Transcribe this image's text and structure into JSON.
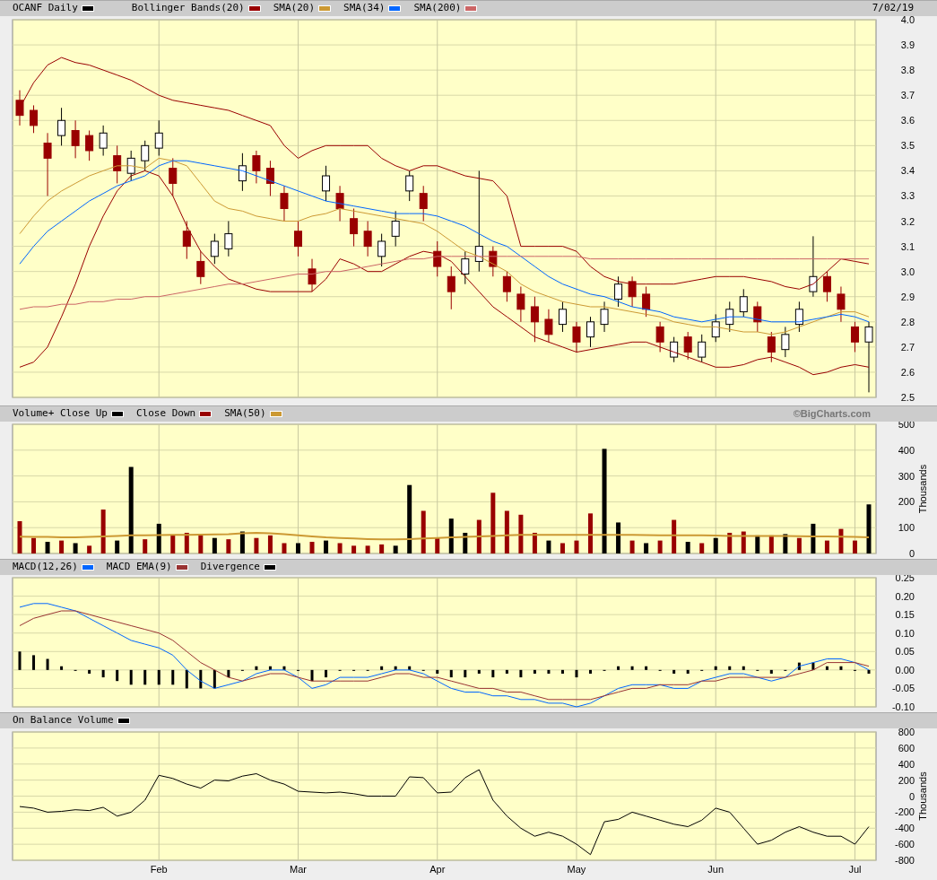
{
  "panels": [
    {
      "date": "7/02/19",
      "chart_data": {
        "type": "line",
        "grid": true,
        "ylim": [
          2.5,
          4.0
        ],
        "yticks": [
          {
            "value": 2.5,
            "label": "2.5"
          },
          {
            "value": 2.6,
            "label": "2.6"
          },
          {
            "value": 2.7,
            "label": "2.7"
          },
          {
            "value": 2.8,
            "label": "2.8"
          },
          {
            "value": 2.9,
            "label": "2.9"
          },
          {
            "value": 3.0,
            "label": "3.0"
          },
          {
            "value": 3.1,
            "label": "3.1"
          },
          {
            "value": 3.2,
            "label": "3.2"
          },
          {
            "value": 3.3,
            "label": "3.3"
          },
          {
            "value": 3.4,
            "label": "3.4"
          },
          {
            "value": 3.5,
            "label": "3.5"
          },
          {
            "value": 3.6,
            "label": "3.6"
          },
          {
            "value": 3.7,
            "label": "3.7"
          },
          {
            "value": 3.8,
            "label": "3.8"
          },
          {
            "value": 3.9,
            "label": "3.9"
          },
          {
            "value": 4.0,
            "label": "4.0"
          }
        ],
        "series": [
          {
            "name": "OCANF Daily",
            "type": "candlestick",
            "ohlc": [
              [
                3.68,
                3.72,
                3.58,
                3.62
              ],
              [
                3.64,
                3.66,
                3.55,
                3.58
              ],
              [
                3.51,
                3.55,
                3.3,
                3.45
              ],
              [
                3.54,
                3.65,
                3.5,
                3.6
              ],
              [
                3.56,
                3.6,
                3.45,
                3.5
              ],
              [
                3.54,
                3.56,
                3.44,
                3.48
              ],
              [
                3.49,
                3.58,
                3.46,
                3.55
              ],
              [
                3.46,
                3.5,
                3.35,
                3.4
              ],
              [
                3.39,
                3.48,
                3.36,
                3.45
              ],
              [
                3.44,
                3.52,
                3.4,
                3.5
              ],
              [
                3.49,
                3.6,
                3.46,
                3.55
              ],
              [
                3.41,
                3.45,
                3.3,
                3.35
              ],
              [
                3.16,
                3.2,
                3.05,
                3.1
              ],
              [
                3.04,
                3.08,
                2.95,
                2.98
              ],
              [
                3.06,
                3.15,
                3.03,
                3.12
              ],
              [
                3.09,
                3.2,
                3.06,
                3.15
              ],
              [
                3.36,
                3.47,
                3.32,
                3.42
              ],
              [
                3.46,
                3.48,
                3.35,
                3.4
              ],
              [
                3.41,
                3.44,
                3.3,
                3.35
              ],
              [
                3.31,
                3.34,
                3.2,
                3.25
              ],
              [
                3.16,
                3.2,
                3.06,
                3.1
              ],
              [
                3.01,
                3.05,
                2.92,
                2.95
              ],
              [
                3.32,
                3.42,
                3.28,
                3.38
              ],
              [
                3.31,
                3.34,
                3.2,
                3.25
              ],
              [
                3.21,
                3.25,
                3.1,
                3.15
              ],
              [
                3.16,
                3.2,
                3.06,
                3.1
              ],
              [
                3.06,
                3.15,
                3.02,
                3.12
              ],
              [
                3.14,
                3.24,
                3.1,
                3.2
              ],
              [
                3.32,
                3.4,
                3.28,
                3.38
              ],
              [
                3.31,
                3.34,
                3.2,
                3.25
              ],
              [
                3.08,
                3.12,
                2.98,
                3.02
              ],
              [
                2.98,
                3.02,
                2.85,
                2.92
              ],
              [
                2.99,
                3.08,
                2.95,
                3.05
              ],
              [
                3.04,
                3.4,
                3.0,
                3.1
              ],
              [
                3.08,
                3.1,
                2.98,
                3.02
              ],
              [
                2.98,
                3.0,
                2.88,
                2.92
              ],
              [
                2.91,
                2.94,
                2.8,
                2.85
              ],
              [
                2.86,
                2.9,
                2.72,
                2.8
              ],
              [
                2.81,
                2.85,
                2.72,
                2.75
              ],
              [
                2.79,
                2.88,
                2.76,
                2.85
              ],
              [
                2.78,
                2.8,
                2.68,
                2.72
              ],
              [
                2.74,
                2.82,
                2.7,
                2.8
              ],
              [
                2.79,
                2.88,
                2.76,
                2.85
              ],
              [
                2.89,
                2.98,
                2.86,
                2.95
              ],
              [
                2.96,
                2.98,
                2.86,
                2.9
              ],
              [
                2.91,
                2.94,
                2.82,
                2.85
              ],
              [
                2.78,
                2.8,
                2.68,
                2.72
              ],
              [
                2.66,
                2.74,
                2.64,
                2.72
              ],
              [
                2.74,
                2.76,
                2.65,
                2.68
              ],
              [
                2.66,
                2.75,
                2.64,
                2.72
              ],
              [
                2.74,
                2.83,
                2.72,
                2.8
              ],
              [
                2.79,
                2.88,
                2.76,
                2.85
              ],
              [
                2.84,
                2.93,
                2.82,
                2.9
              ],
              [
                2.86,
                2.88,
                2.76,
                2.8
              ],
              [
                2.74,
                2.76,
                2.64,
                2.68
              ],
              [
                2.69,
                2.78,
                2.66,
                2.75
              ],
              [
                2.79,
                2.88,
                2.76,
                2.85
              ],
              [
                2.92,
                3.14,
                2.9,
                2.98
              ],
              [
                2.98,
                3.0,
                2.88,
                2.92
              ],
              [
                2.91,
                2.94,
                2.8,
                2.85
              ],
              [
                2.78,
                2.8,
                2.68,
                2.72
              ],
              [
                2.72,
                2.8,
                2.52,
                2.78
              ]
            ]
          },
          {
            "name": "Bollinger Bands(20)",
            "type": "line",
            "color": "#990000",
            "values": [
              3.65,
              3.75,
              3.82,
              3.85,
              3.83,
              3.82,
              3.8,
              3.78,
              3.76,
              3.73,
              3.7,
              3.68,
              3.67,
              3.66,
              3.65,
              3.64,
              3.62,
              3.6,
              3.58,
              3.5,
              3.45,
              3.48,
              3.5,
              3.5,
              3.5,
              3.5,
              3.45,
              3.42,
              3.4,
              3.42,
              3.42,
              3.4,
              3.38,
              3.37,
              3.36,
              3.3,
              3.1,
              3.1,
              3.1,
              3.1,
              3.08,
              3.02,
              2.98,
              2.96,
              2.95,
              2.95,
              2.95,
              2.95,
              2.96,
              2.97,
              2.98,
              2.98,
              2.98,
              2.97,
              2.96,
              2.94,
              2.93,
              2.95,
              3.0,
              3.05,
              3.04,
              3.03
            ]
          },
          {
            "type": "line",
            "color": "#990000",
            "values": [
              2.62,
              2.64,
              2.7,
              2.82,
              2.95,
              3.1,
              3.22,
              3.32,
              3.38,
              3.4,
              3.38,
              3.3,
              3.18,
              3.08,
              3.02,
              2.97,
              2.95,
              2.93,
              2.92,
              2.92,
              2.92,
              2.92,
              2.97,
              3.05,
              3.03,
              3.0,
              3.0,
              3.03,
              3.06,
              3.08,
              3.07,
              3.04,
              2.98,
              2.92,
              2.86,
              2.82,
              2.78,
              2.74,
              2.72,
              2.7,
              2.68,
              2.69,
              2.7,
              2.71,
              2.72,
              2.72,
              2.7,
              2.68,
              2.66,
              2.64,
              2.62,
              2.62,
              2.63,
              2.65,
              2.66,
              2.64,
              2.62,
              2.59,
              2.6,
              2.62,
              2.63,
              2.62
            ]
          },
          {
            "name": "SMA(20)",
            "type": "line",
            "color": "#cc9933",
            "values": [
              3.15,
              3.22,
              3.28,
              3.32,
              3.35,
              3.38,
              3.4,
              3.42,
              3.42,
              3.41,
              3.45,
              3.44,
              3.42,
              3.35,
              3.28,
              3.25,
              3.24,
              3.22,
              3.21,
              3.2,
              3.2,
              3.22,
              3.23,
              3.25,
              3.24,
              3.23,
              3.22,
              3.21,
              3.2,
              3.19,
              3.16,
              3.12,
              3.08,
              3.06,
              3.03,
              3.0,
              2.95,
              2.92,
              2.9,
              2.88,
              2.87,
              2.86,
              2.86,
              2.85,
              2.84,
              2.83,
              2.82,
              2.8,
              2.79,
              2.78,
              2.78,
              2.77,
              2.76,
              2.76,
              2.75,
              2.76,
              2.78,
              2.8,
              2.82,
              2.84,
              2.84,
              2.82
            ]
          },
          {
            "name": "SMA(34)",
            "type": "line",
            "color": "#0066ff",
            "values": [
              3.03,
              3.1,
              3.16,
              3.2,
              3.24,
              3.28,
              3.31,
              3.34,
              3.36,
              3.38,
              3.42,
              3.44,
              3.44,
              3.43,
              3.42,
              3.41,
              3.4,
              3.38,
              3.36,
              3.34,
              3.32,
              3.3,
              3.28,
              3.27,
              3.26,
              3.25,
              3.24,
              3.23,
              3.23,
              3.23,
              3.22,
              3.2,
              3.18,
              3.15,
              3.12,
              3.1,
              3.06,
              3.02,
              2.98,
              2.95,
              2.93,
              2.91,
              2.9,
              2.88,
              2.86,
              2.85,
              2.84,
              2.82,
              2.81,
              2.8,
              2.81,
              2.82,
              2.82,
              2.81,
              2.8,
              2.8,
              2.8,
              2.81,
              2.82,
              2.83,
              2.82,
              2.8
            ]
          },
          {
            "name": "SMA(200)",
            "type": "line",
            "color": "#cc6666",
            "values": [
              2.85,
              2.86,
              2.86,
              2.87,
              2.87,
              2.88,
              2.88,
              2.89,
              2.89,
              2.9,
              2.9,
              2.91,
              2.92,
              2.93,
              2.94,
              2.95,
              2.95,
              2.96,
              2.97,
              2.98,
              2.99,
              2.99,
              3.0,
              3.0,
              3.01,
              3.02,
              3.03,
              3.04,
              3.05,
              3.05,
              3.06,
              3.06,
              3.06,
              3.06,
              3.06,
              3.06,
              3.06,
              3.06,
              3.06,
              3.06,
              3.06,
              3.05,
              3.05,
              3.05,
              3.05,
              3.05,
              3.05,
              3.05,
              3.05,
              3.05,
              3.05,
              3.05,
              3.05,
              3.05,
              3.05,
              3.05,
              3.05,
              3.05,
              3.05,
              3.05,
              3.05,
              3.05
            ]
          }
        ]
      }
    },
    {
      "credit": "©BigCharts.com",
      "chart_data": {
        "type": "bar",
        "grid": true,
        "ylabel": "Thousands",
        "ylim": [
          0,
          500
        ],
        "yticks": [
          0,
          100,
          200,
          300,
          400,
          500
        ],
        "series": [
          {
            "name": "Volume+ Close Up",
            "type": "bar",
            "color": "#000000",
            "values": [
              null,
              null,
              45,
              null,
              40,
              null,
              null,
              50,
              335,
              null,
              115,
              null,
              null,
              null,
              60,
              null,
              85,
              null,
              null,
              null,
              40,
              null,
              50,
              null,
              null,
              null,
              null,
              30,
              265,
              null,
              null,
              135,
              80,
              null,
              null,
              null,
              null,
              null,
              50,
              null,
              null,
              null,
              405,
              120,
              null,
              40,
              null,
              null,
              45,
              null,
              60,
              null,
              null,
              70,
              null,
              75,
              null,
              115,
              null,
              null,
              null,
              190
            ]
          },
          {
            "name": "Close Down",
            "type": "bar",
            "color": "#990000",
            "values": [
              125,
              60,
              null,
              50,
              null,
              30,
              170,
              null,
              null,
              55,
              null,
              70,
              80,
              75,
              null,
              55,
              null,
              60,
              70,
              40,
              null,
              45,
              null,
              40,
              30,
              30,
              35,
              null,
              null,
              165,
              60,
              null,
              null,
              130,
              235,
              165,
              150,
              80,
              null,
              40,
              50,
              155,
              null,
              null,
              50,
              null,
              50,
              130,
              null,
              40,
              null,
              80,
              85,
              null,
              70,
              null,
              60,
              null,
              50,
              95,
              50,
              null
            ]
          },
          {
            "name": "SMA(50)",
            "type": "line",
            "color": "#cc9933",
            "values": [
              65,
              64,
              64,
              63,
              63,
              64,
              66,
              68,
              70,
              70,
              71,
              72,
              72,
              73,
              74,
              75,
              78,
              80,
              78,
              75,
              70,
              66,
              62,
              60,
              58,
              56,
              55,
              55,
              56,
              58,
              60,
              62,
              64,
              66,
              68,
              70,
              72,
              72,
              72,
              72,
              72,
              72,
              72,
              72,
              72,
              71,
              70,
              70,
              70,
              70,
              69,
              68,
              68,
              68,
              68,
              68,
              67,
              66,
              66,
              65,
              64,
              63
            ]
          }
        ]
      }
    },
    {
      "chart_data": {
        "type": "line",
        "grid": true,
        "ylim": [
          -0.1,
          0.25
        ],
        "yticks": [
          {
            "value": -0.1,
            "label": "-0.10"
          },
          {
            "value": -0.05,
            "label": "-0.05"
          },
          {
            "value": 0,
            "label": "0.00"
          },
          {
            "value": 0.05,
            "label": "0.05"
          },
          {
            "value": 0.1,
            "label": "0.10"
          },
          {
            "value": 0.15,
            "label": "0.15"
          },
          {
            "value": 0.2,
            "label": "0.20"
          },
          {
            "value": 0.25,
            "label": "0.25"
          }
        ],
        "series": [
          {
            "name": "MACD(12,26)",
            "type": "line",
            "color": "#0066ff",
            "values": [
              0.17,
              0.18,
              0.18,
              0.17,
              0.16,
              0.14,
              0.12,
              0.1,
              0.08,
              0.07,
              0.06,
              0.04,
              0.0,
              -0.03,
              -0.05,
              -0.04,
              -0.03,
              -0.01,
              0.0,
              0.0,
              -0.02,
              -0.05,
              -0.04,
              -0.02,
              -0.02,
              -0.02,
              -0.01,
              0.0,
              0.0,
              -0.01,
              -0.03,
              -0.05,
              -0.06,
              -0.06,
              -0.07,
              -0.07,
              -0.08,
              -0.08,
              -0.09,
              -0.09,
              -0.1,
              -0.09,
              -0.07,
              -0.05,
              -0.04,
              -0.04,
              -0.04,
              -0.05,
              -0.05,
              -0.03,
              -0.02,
              -0.01,
              -0.01,
              -0.02,
              -0.03,
              -0.02,
              0.01,
              0.02,
              0.03,
              0.03,
              0.02,
              0.0
            ]
          },
          {
            "name": "MACD EMA(9)",
            "type": "line",
            "color": "#993333",
            "values": [
              0.12,
              0.14,
              0.15,
              0.16,
              0.16,
              0.15,
              0.14,
              0.13,
              0.12,
              0.11,
              0.1,
              0.08,
              0.05,
              0.02,
              0.0,
              -0.02,
              -0.03,
              -0.02,
              -0.01,
              -0.01,
              -0.02,
              -0.03,
              -0.03,
              -0.03,
              -0.03,
              -0.03,
              -0.02,
              -0.01,
              -0.01,
              -0.02,
              -0.02,
              -0.03,
              -0.04,
              -0.05,
              -0.05,
              -0.06,
              -0.06,
              -0.07,
              -0.08,
              -0.08,
              -0.08,
              -0.08,
              -0.07,
              -0.06,
              -0.05,
              -0.05,
              -0.04,
              -0.04,
              -0.04,
              -0.03,
              -0.03,
              -0.02,
              -0.02,
              -0.02,
              -0.02,
              -0.02,
              -0.01,
              0.0,
              0.02,
              0.02,
              0.02,
              0.01
            ]
          },
          {
            "name": "Divergence",
            "type": "bar",
            "color": "#000000",
            "values": [
              0.05,
              0.04,
              0.03,
              0.01,
              0.0,
              -0.01,
              -0.02,
              -0.03,
              -0.04,
              -0.04,
              -0.04,
              -0.04,
              -0.05,
              -0.05,
              -0.05,
              -0.02,
              0.0,
              0.01,
              0.01,
              0.01,
              0.0,
              -0.03,
              -0.02,
              0.0,
              0.0,
              0.0,
              0.01,
              0.01,
              0.01,
              0.0,
              -0.01,
              -0.02,
              -0.02,
              -0.01,
              -0.02,
              -0.01,
              -0.02,
              -0.01,
              -0.01,
              -0.01,
              -0.02,
              -0.01,
              0.0,
              0.01,
              0.01,
              0.01,
              0.0,
              -0.01,
              -0.01,
              0.0,
              0.01,
              0.01,
              0.01,
              0.0,
              -0.01,
              0.0,
              0.02,
              0.02,
              0.01,
              0.01,
              0.0,
              -0.01
            ]
          }
        ]
      }
    },
    {
      "x_labels": [
        "Feb",
        "Mar",
        "Apr",
        "May",
        "Jun",
        "Jul"
      ],
      "chart_data": {
        "type": "line",
        "grid": true,
        "ylabel": "Thousands",
        "ylim": [
          -800,
          800
        ],
        "yticks": [
          -800,
          -600,
          -400,
          -200,
          0,
          200,
          400,
          600,
          800
        ],
        "series": [
          {
            "name": "On Balance Volume",
            "type": "line",
            "color": "#000000",
            "values": [
              -130,
              -150,
              -200,
              -190,
              -170,
              -180,
              -140,
              -250,
              -200,
              -50,
              260,
              220,
              150,
              100,
              200,
              190,
              250,
              280,
              200,
              150,
              60,
              50,
              40,
              50,
              30,
              0,
              0,
              0,
              240,
              230,
              40,
              50,
              230,
              330,
              -50,
              -250,
              -400,
              -500,
              -450,
              -500,
              -600,
              -730,
              -320,
              -290,
              -200,
              -250,
              -300,
              -350,
              -380,
              -300,
              -150,
              -200,
              -400,
              -600,
              -550,
              -450,
              -380,
              -450,
              -500,
              -500,
              -600,
              -380
            ]
          }
        ]
      }
    }
  ]
}
